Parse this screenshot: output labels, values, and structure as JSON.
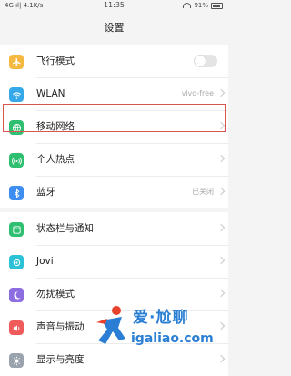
{
  "status_bar": {
    "carrier": "4G ıl| 4.1K/s",
    "time": "11:35",
    "battery": "91%"
  },
  "header": {
    "title": "设置"
  },
  "group1": [
    {
      "label": "飞行模式",
      "icon": "airplane-icon",
      "color": "#f5b942",
      "control": "toggle"
    },
    {
      "label": "WLAN",
      "icon": "wifi-icon",
      "color": "#34a8e8",
      "value": "vivo-free"
    },
    {
      "label": "移动网络",
      "icon": "globe-icon",
      "color": "#2fbf71"
    },
    {
      "label": "个人热点",
      "icon": "hotspot-icon",
      "color": "#2fbf71"
    },
    {
      "label": "蓝牙",
      "icon": "bluetooth-icon",
      "color": "#3d8ef0",
      "value": "已关闭"
    }
  ],
  "group2": [
    {
      "label": "状态栏与通知",
      "icon": "notification-icon",
      "color": "#2fbf71"
    },
    {
      "label": "Jovi",
      "icon": "jovi-icon",
      "color": "#2bc1d6"
    },
    {
      "label": "勿扰模式",
      "icon": "moon-icon",
      "color": "#8c6ee0"
    },
    {
      "label": "声音与振动",
      "icon": "sound-icon",
      "color": "#ef5a5a"
    },
    {
      "label": "显示与亮度",
      "icon": "brightness-icon",
      "color": "#9aa3ad"
    }
  ],
  "highlight_color": "#d9534f",
  "watermark": {
    "title": "爱·尬聊",
    "url": "igaliao.com"
  }
}
